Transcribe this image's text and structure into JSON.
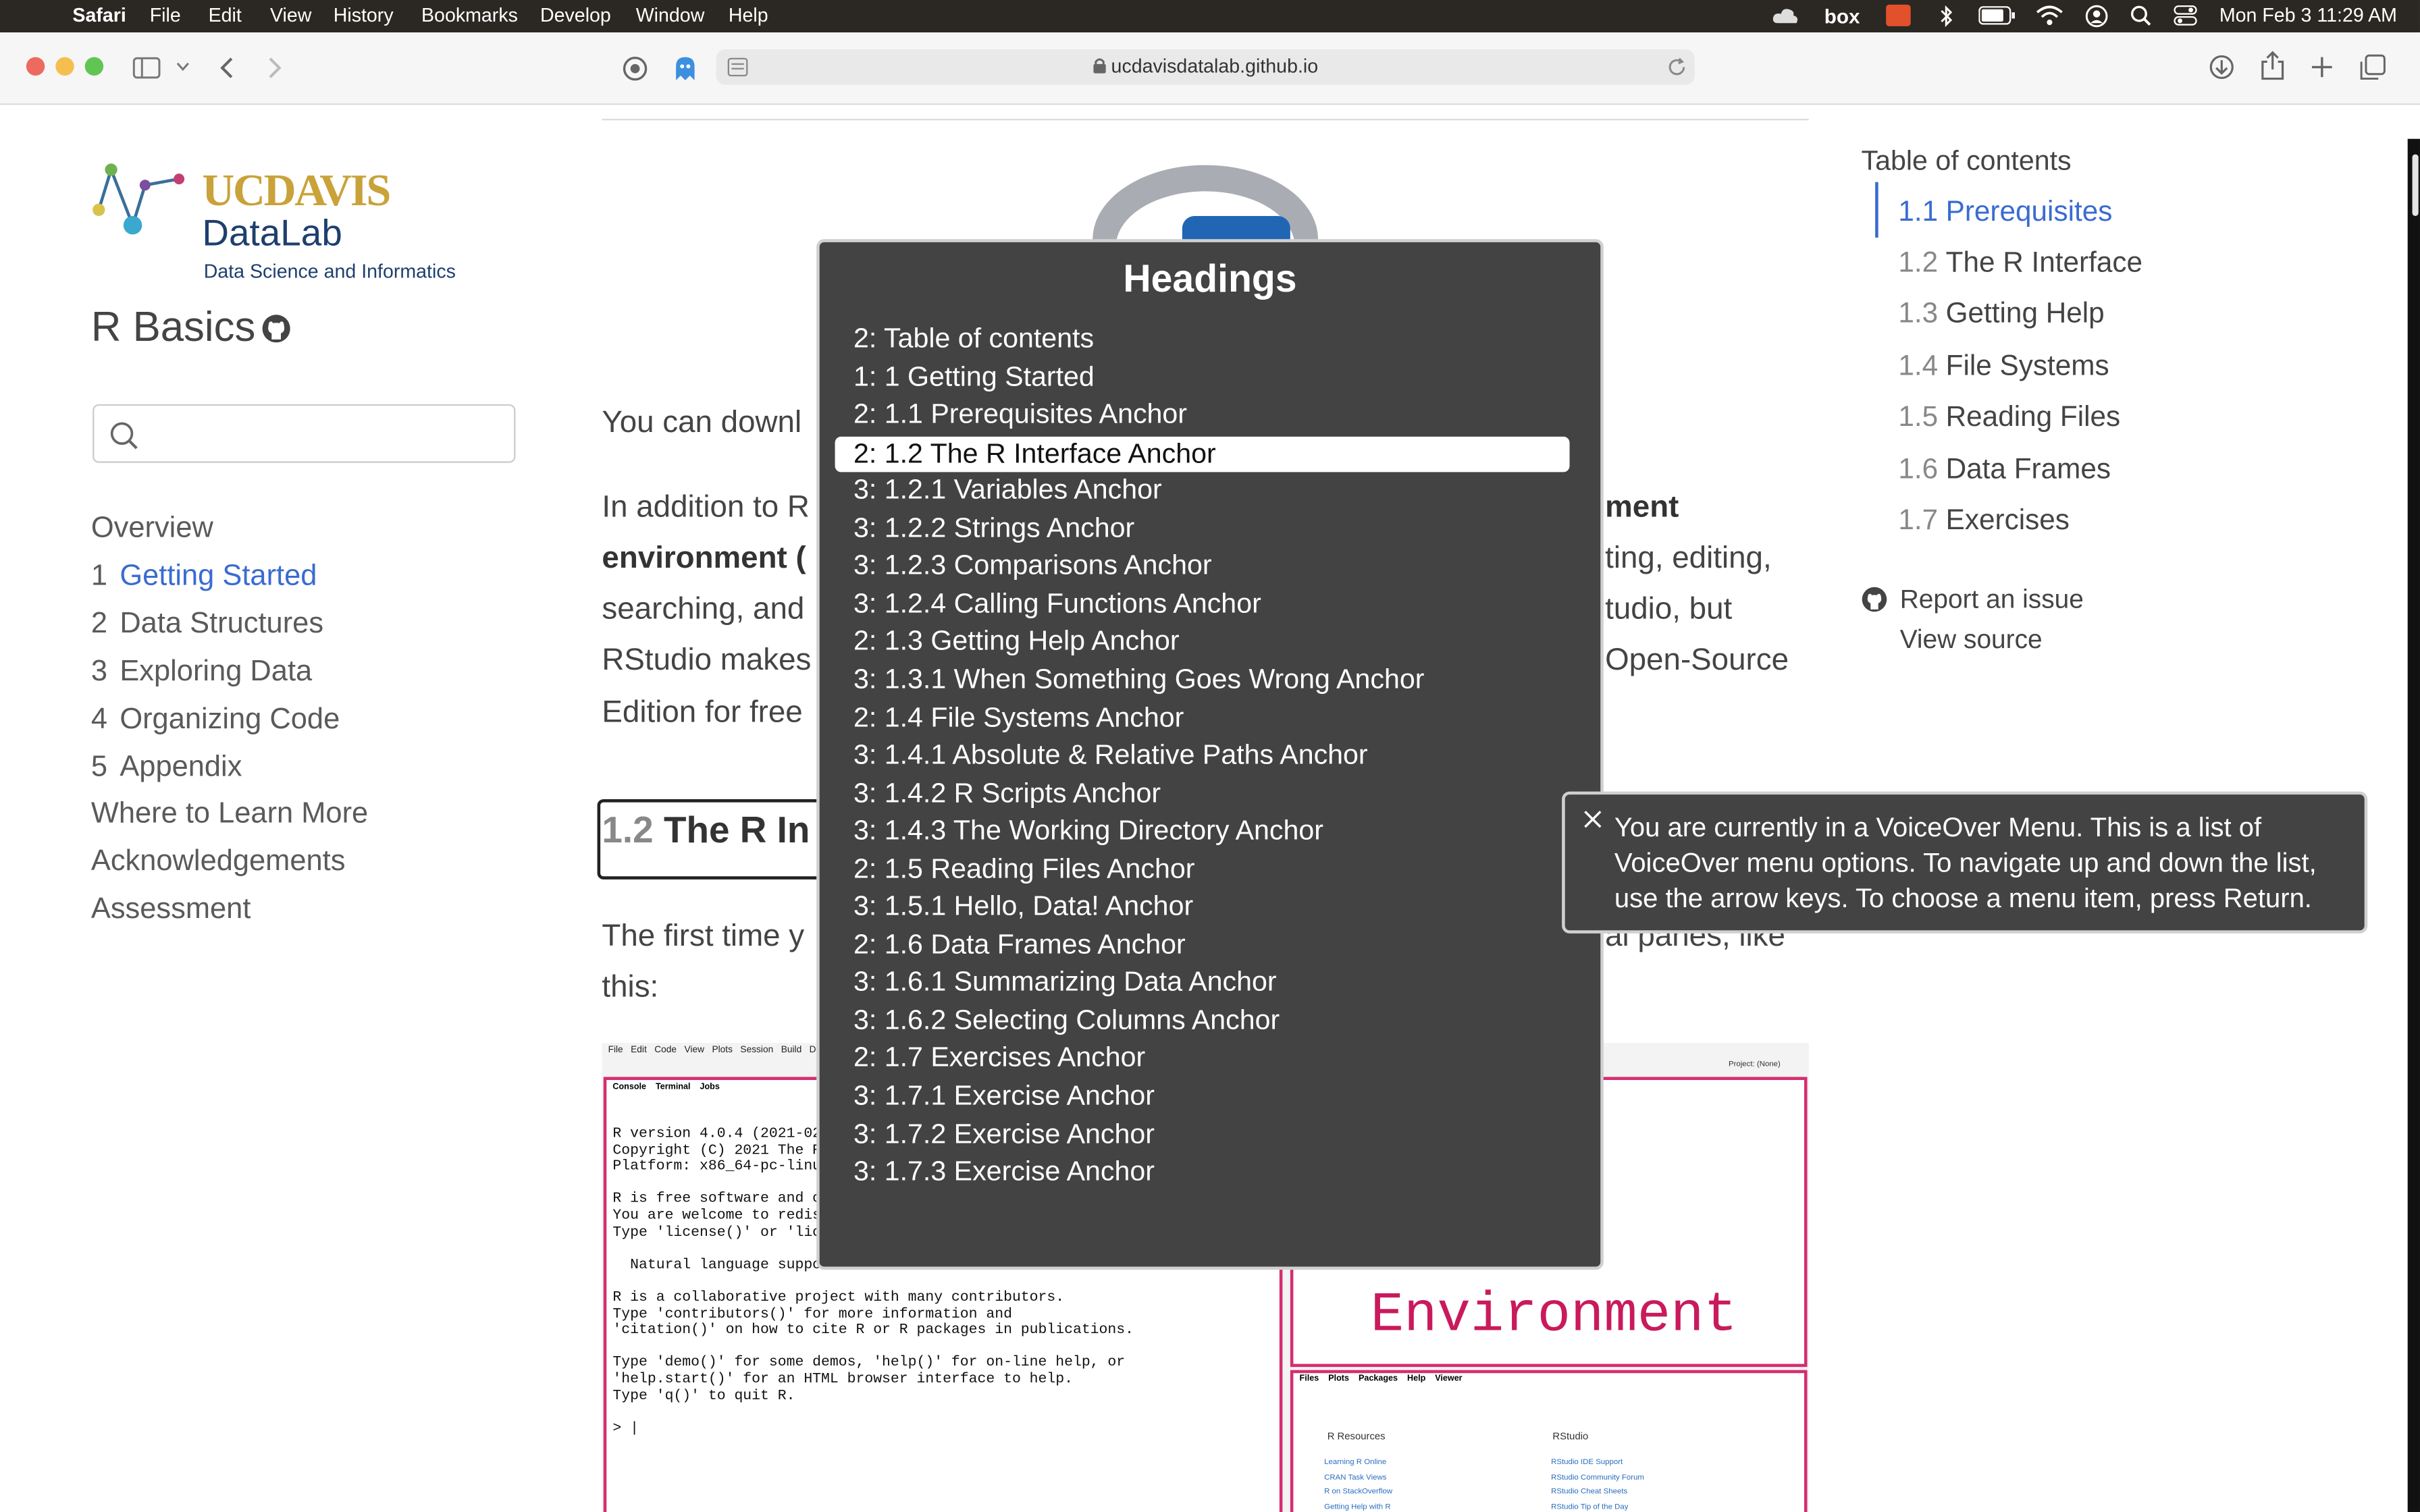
{
  "menubar": {
    "app": "Safari",
    "items": [
      "File",
      "Edit",
      "View",
      "History",
      "Bookmarks",
      "Develop",
      "Window",
      "Help"
    ],
    "datetime": "Mon Feb 3  11:29 AM",
    "box_label": "box"
  },
  "browser": {
    "url": "ucdavisdatalab.github.io"
  },
  "sidebar": {
    "logo_uc": "UC",
    "logo_davis": "DAVIS",
    "logo_datalab": "DataLab",
    "logo_sub": "Data Science and Informatics",
    "book_title": "R Basics",
    "search_placeholder": "",
    "nav": [
      {
        "num": "",
        "label": "Overview"
      },
      {
        "num": "1",
        "label": "Getting Started"
      },
      {
        "num": "2",
        "label": "Data Structures"
      },
      {
        "num": "3",
        "label": "Exploring Data"
      },
      {
        "num": "4",
        "label": "Organizing Code"
      },
      {
        "num": "5",
        "label": "Appendix"
      },
      {
        "num": "",
        "label": "Where to Learn More"
      },
      {
        "num": "",
        "label": "Acknowledgements"
      },
      {
        "num": "",
        "label": "Assessment"
      }
    ]
  },
  "main": {
    "p1": "You can downl",
    "p2_l1a": "In addition to R",
    "p2_l1b": "ment",
    "p2_l2a": "environment (",
    "p2_l2b": "ting, editing,",
    "p2_l3a": "searching, and",
    "p2_l3b": "tudio, but",
    "p2_l4a": "RStudio makes",
    "p2_l4b": "Open-Source",
    "p2_l5a": "Edition for free",
    "h2_num": "1.2",
    "h2_text": "The R In",
    "p3_l1a": "The first time y",
    "p3_l1b": "al panes, like",
    "p3_l2": "this:",
    "rstudio_menu": [
      "File",
      "Edit",
      "Code",
      "View",
      "Plots",
      "Session",
      "Build",
      "De"
    ],
    "console_tabs": [
      "Console",
      "Terminal",
      "Jobs"
    ],
    "console_lines": [
      "R version 4.0.4 (2021-02-",
      "Copyright (C) 2021 The R",
      "Platform: x86_64-pc-linux",
      "",
      "R is free software and co",
      "You are welcome to redist",
      "Type 'license()' or 'lice",
      "",
      "  Natural language suppor",
      "",
      "R is a collaborative project with many contributors.",
      "Type 'contributors()' for more information and",
      "'citation()' on how to cite R or R packages in publications.",
      "",
      "Type 'demo()' for some demos, 'help()' for on-line help, or",
      "'help.start()' for an HTML browser interface to help.",
      "Type 'q()' to quit R.",
      "",
      "> |"
    ],
    "env_label": "Environment",
    "files_tabs": [
      "Files",
      "Plots",
      "Packages",
      "Help",
      "Viewer"
    ],
    "project_label": "Project: (None)",
    "r_resources": "R Resources",
    "rstudio_col": "RStudio",
    "links_left": [
      "Learning R Online",
      "CRAN Task Views",
      "R on StackOverflow",
      "Getting Help with R"
    ],
    "links_right": [
      "RStudio IDE Support",
      "RStudio Community Forum",
      "RStudio Cheat Sheets",
      "RStudio Tip of the Day"
    ]
  },
  "toc": {
    "title": "Table of contents",
    "items": [
      {
        "num": "1.1",
        "label": "Prerequisites"
      },
      {
        "num": "1.2",
        "label": "The R Interface"
      },
      {
        "num": "1.3",
        "label": "Getting Help"
      },
      {
        "num": "1.4",
        "label": "File Systems"
      },
      {
        "num": "1.5",
        "label": "Reading Files"
      },
      {
        "num": "1.6",
        "label": "Data Frames"
      },
      {
        "num": "1.7",
        "label": "Exercises"
      }
    ],
    "report": "Report an issue",
    "source": "View source"
  },
  "voiceover": {
    "menu_title": "Headings",
    "items": [
      "2: Table of contents",
      "1: 1  Getting Started",
      "2: 1.1 Prerequisites Anchor",
      "2: 1.2 The R Interface Anchor",
      "3: 1.2.1 Variables Anchor",
      "3: 1.2.2 Strings Anchor",
      "3: 1.2.3 Comparisons Anchor",
      "3: 1.2.4 Calling Functions Anchor",
      "2: 1.3 Getting Help Anchor",
      "3: 1.3.1 When Something Goes Wrong Anchor",
      "2: 1.4 File Systems Anchor",
      "3: 1.4.1 Absolute & Relative Paths Anchor",
      "3: 1.4.2 R Scripts Anchor",
      "3: 1.4.3 The Working Directory Anchor",
      "2: 1.5 Reading Files Anchor",
      "3: 1.5.1 Hello, Data! Anchor",
      "2: 1.6 Data Frames Anchor",
      "3: 1.6.1 Summarizing Data Anchor",
      "3: 1.6.2 Selecting Columns Anchor",
      "2: 1.7 Exercises Anchor",
      "3: 1.7.1 Exercise Anchor",
      "3: 1.7.2 Exercise Anchor",
      "3: 1.7.3 Exercise Anchor"
    ],
    "selected_index": 3,
    "hint": "You are currently in a VoiceOver Menu. This is a list of VoiceOver menu options. To navigate up and down the list, use the arrow keys. To choose a menu item, press Return."
  }
}
